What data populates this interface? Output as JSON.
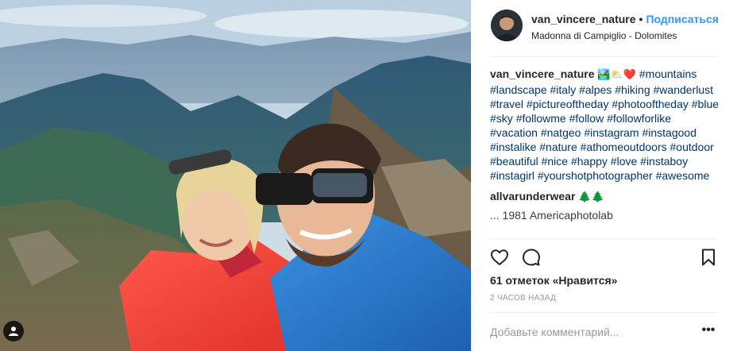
{
  "post": {
    "photo_alt": "",
    "user_tag_icon": "person-icon"
  },
  "header": {
    "username": "van_vincere_nature",
    "separator": "•",
    "follow_label": "Подписаться",
    "location": "Madonna di Campiglio - Dolomites"
  },
  "caption": {
    "username": "van_vincere_nature",
    "emoji": "🏞️⛅❤️",
    "hashtags": [
      "#mountains",
      "#landscape",
      "#italy",
      "#alpes",
      "#hiking",
      "#wanderlust",
      "#travel",
      "#pictureoftheday",
      "#photooftheday",
      "#blue",
      "#sky",
      "#followme",
      "#follow",
      "#followforlike",
      "#vacation",
      "#natgeo",
      "#instagram",
      "#instagood",
      "#instalike",
      "#nature",
      "#athomeoutdoors",
      "#outdoor",
      "#beautiful",
      "#nice",
      "#happy",
      "#love",
      "#instaboy",
      "#instagirl",
      "#yourshotphotographer",
      "#awesome"
    ]
  },
  "comments": [
    {
      "username": "allvarunderwear",
      "text": "🌲🌲"
    }
  ],
  "partial_comment": "... 1981 Americaphotolab",
  "actions": {
    "like_icon": "heart-icon",
    "comment_icon": "comment-icon",
    "save_icon": "bookmark-icon"
  },
  "likes_text": "61 отметок «Нравится»",
  "time_text": "2 часов назад",
  "comment_box": {
    "placeholder": "Добавьте комментарий...",
    "more_label": "•••"
  },
  "colors": {
    "link": "#003569",
    "follow": "#3897f0",
    "text": "#262626",
    "muted": "#999999"
  }
}
